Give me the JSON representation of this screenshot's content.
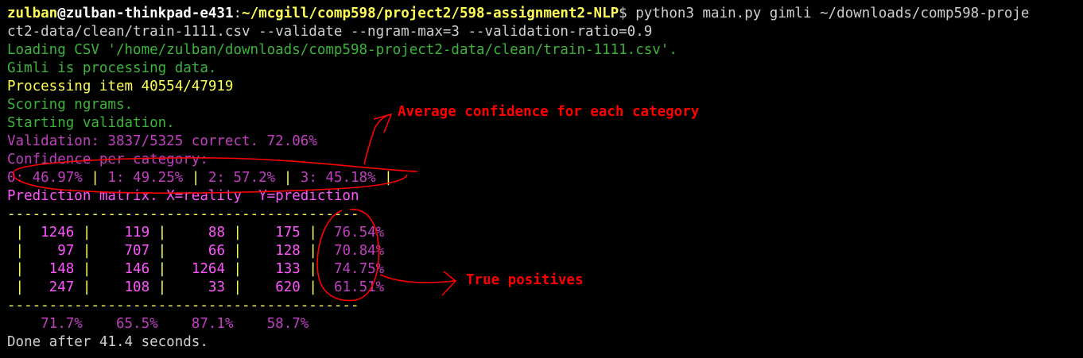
{
  "prompt": {
    "user": "zulban",
    "at": "@",
    "host": "zulban-thinkpad-e431",
    "colon": ":",
    "path": "~/mcgill/comp598/project2/598-assignment2-NLP",
    "dollar": "$ ",
    "command_part1": "python3 main.py gimli ~/downloads/comp598-proje",
    "command_part2": "ct2-data/clean/train-1111.csv --validate --ngram-max=3 --validation-ratio=0.9"
  },
  "output": {
    "loading": "Loading CSV '/home/zulban/downloads/comp598-project2-data/clean/train-1111.csv'.",
    "processing_data": "Gimli is processing data.",
    "processing_item": "Processing item 40554/47919",
    "scoring": "Scoring ngrams.",
    "starting_validation": "Starting validation.",
    "validation": "Validation: 3837/5325 correct. 72.06%",
    "confidence_header": "Confidence per category:",
    "confidence": [
      {
        "label": "0: 46.97% "
      },
      {
        "label": " 1: 49.25% "
      },
      {
        "label": " 2: 57.2% "
      },
      {
        "label": " 3: 45.18% "
      }
    ],
    "matrix_header": "Prediction matrix. X=reality  Y=prediction",
    "divider": "------------------------------------------",
    "matrix_rows": [
      {
        "cells": [
          "1246",
          "119",
          "88",
          "175"
        ],
        "percent": "76.54%"
      },
      {
        "cells": [
          "97",
          "707",
          "66",
          "128"
        ],
        "percent": "70.84%"
      },
      {
        "cells": [
          "148",
          "146",
          "1264",
          "133"
        ],
        "percent": "74.75%"
      },
      {
        "cells": [
          "247",
          "108",
          "33",
          "620"
        ],
        "percent": "61.51%"
      }
    ],
    "column_percents": [
      "71.7%",
      "65.5%",
      "87.1%",
      "58.7%"
    ],
    "done": "Done after 41.4 seconds."
  },
  "annotations": {
    "confidence_note": "Average confidence for each category",
    "true_positive_note": "True positives",
    "color": "#ff0000"
  }
}
